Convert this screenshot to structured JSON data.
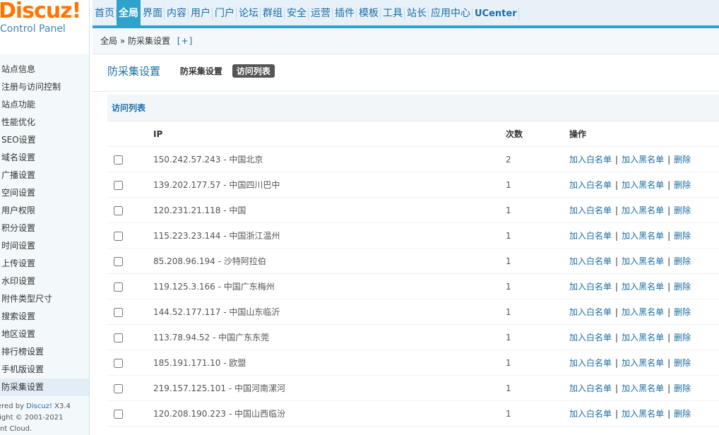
{
  "logo": {
    "brand": "Discuz!",
    "subtitle": "Control Panel"
  },
  "topnav": [
    {
      "label": "首页",
      "active": false
    },
    {
      "label": "全局",
      "active": true
    },
    {
      "label": "界面",
      "active": false
    },
    {
      "label": "内容",
      "active": false
    },
    {
      "label": "用户",
      "active": false
    },
    {
      "label": "门户",
      "active": false
    },
    {
      "label": "论坛",
      "active": false
    },
    {
      "label": "群组",
      "active": false
    },
    {
      "label": "安全",
      "active": false
    },
    {
      "label": "运营",
      "active": false
    },
    {
      "label": "插件",
      "active": false
    },
    {
      "label": "模板",
      "active": false
    },
    {
      "label": "工具",
      "active": false
    },
    {
      "label": "站长",
      "active": false
    },
    {
      "label": "应用中心",
      "active": false
    },
    {
      "label": "UCenter",
      "active": false
    }
  ],
  "breadcrumb": {
    "root": "全局",
    "sep": " » ",
    "current": "防采集设置",
    "add": "[+]"
  },
  "sidebar": {
    "items": [
      {
        "label": "站点信息",
        "active": false
      },
      {
        "label": "注册与访问控制",
        "active": false
      },
      {
        "label": "站点功能",
        "active": false
      },
      {
        "label": "性能优化",
        "active": false
      },
      {
        "label": "SEO设置",
        "active": false
      },
      {
        "label": "域名设置",
        "active": false
      },
      {
        "label": "广播设置",
        "active": false
      },
      {
        "label": "空间设置",
        "active": false
      },
      {
        "label": "用户权限",
        "active": false
      },
      {
        "label": "积分设置",
        "active": false
      },
      {
        "label": "时间设置",
        "active": false
      },
      {
        "label": "上传设置",
        "active": false
      },
      {
        "label": "水印设置",
        "active": false
      },
      {
        "label": "附件类型尺寸",
        "active": false
      },
      {
        "label": "搜索设置",
        "active": false
      },
      {
        "label": "地区设置",
        "active": false
      },
      {
        "label": "排行榜设置",
        "active": false
      },
      {
        "label": "手机版设置",
        "active": false
      },
      {
        "label": "防采集设置",
        "active": true
      }
    ]
  },
  "copyright": {
    "line1_prefix": "ered by ",
    "line1_brand": "Discuz!",
    "line1_version": " X3.4",
    "line2": "right © 2001-2021",
    "line3": "nt Cloud."
  },
  "main": {
    "title": "防采集设置",
    "tabs": [
      {
        "label": "防采集设置",
        "active": false
      },
      {
        "label": "访问列表",
        "active": true
      }
    ],
    "section_title": "访问列表",
    "columns": {
      "ip": "IP",
      "count": "次数",
      "ops": "操作"
    },
    "op_labels": {
      "whitelist": "加入白名单",
      "blacklist": "加入黑名单",
      "delete": "删除",
      "sep": "|"
    },
    "rows": [
      {
        "ip": "150.242.57.243 - 中国北京",
        "count": "2"
      },
      {
        "ip": "139.202.177.57 - 中国四川巴中",
        "count": "1"
      },
      {
        "ip": "120.231.21.118 - 中国",
        "count": "1"
      },
      {
        "ip": "115.223.23.144 - 中国浙江温州",
        "count": "1"
      },
      {
        "ip": "85.208.96.194 - 沙特阿拉伯",
        "count": "1"
      },
      {
        "ip": "119.125.3.166 - 中国广东梅州",
        "count": "1"
      },
      {
        "ip": "144.52.177.117 - 中国山东临沂",
        "count": "1"
      },
      {
        "ip": "113.78.94.52 - 中国广东东莞",
        "count": "1"
      },
      {
        "ip": "185.191.171.10 - 欧盟",
        "count": "1"
      },
      {
        "ip": "219.157.125.101 - 中国河南漯河",
        "count": "1"
      },
      {
        "ip": "120.208.190.223 - 中国山西临汾",
        "count": "1"
      }
    ]
  }
}
